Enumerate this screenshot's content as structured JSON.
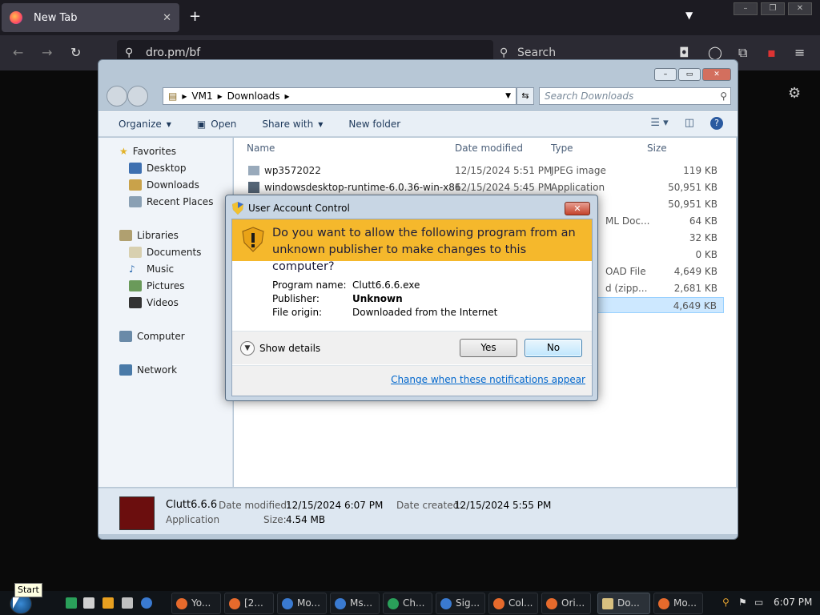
{
  "browser": {
    "tab_label": "New Tab",
    "tab_close": "✕",
    "new_tab": "+",
    "url": "dro.pm/bf",
    "search_placeholder": "Search"
  },
  "explorer": {
    "breadcrumb": [
      "VM1",
      "Downloads"
    ],
    "search_placeholder": "Search Downloads",
    "toolbar": {
      "organize": "Organize",
      "open": "Open",
      "share_with": "Share with",
      "new_folder": "New folder"
    },
    "nav": {
      "favorites": "Favorites",
      "desktop": "Desktop",
      "downloads": "Downloads",
      "recent": "Recent Places",
      "libraries": "Libraries",
      "documents": "Documents",
      "music": "Music",
      "pictures": "Pictures",
      "videos": "Videos",
      "computer": "Computer",
      "network": "Network"
    },
    "columns": {
      "name": "Name",
      "date": "Date modified",
      "type": "Type",
      "size": "Size"
    },
    "rows": [
      {
        "name": "wp3572022",
        "date": "12/15/2024 5:51 PM",
        "type": "JPEG image",
        "size": "119 KB"
      },
      {
        "name": "windowsdesktop-runtime-6.0.36-win-x86",
        "date": "12/15/2024 5:45 PM",
        "type": "Application",
        "size": "50,951 KB"
      },
      {
        "name": "",
        "date": "",
        "type": "",
        "size": "50,951 KB"
      },
      {
        "name": "",
        "date": "",
        "type": "ML Doc...",
        "size": "64 KB"
      },
      {
        "name": "",
        "date": "",
        "type": "",
        "size": "32 KB"
      },
      {
        "name": "",
        "date": "",
        "type": "",
        "size": "0 KB"
      },
      {
        "name": "",
        "date": "",
        "type": "OAD File",
        "size": "4,649 KB"
      },
      {
        "name": "",
        "date": "",
        "type": "d (zipp...",
        "size": "2,681 KB"
      },
      {
        "name": "",
        "date": "",
        "type": "",
        "size": "4,649 KB"
      }
    ],
    "details": {
      "name": "Clutt6.6.6",
      "kind": "Application",
      "modified_label": "Date modified:",
      "modified": "12/15/2024 6:07 PM",
      "size_label": "Size:",
      "size": "4.54 MB",
      "created_label": "Date created:",
      "created": "12/15/2024 5:55 PM"
    }
  },
  "uac": {
    "title": "User Account Control",
    "question_line1": "Do you want to allow the following program from an",
    "question_line2": "unknown publisher to make changes to this computer?",
    "program_label": "Program name:",
    "program_value": "Clutt6.6.6.exe",
    "publisher_label": "Publisher:",
    "publisher_value": "Unknown",
    "origin_label": "File origin:",
    "origin_value": "Downloaded from the Internet",
    "show_details": "Show details",
    "yes": "Yes",
    "no": "No",
    "link": "Change when these notifications appear"
  },
  "taskbar": {
    "start_tooltip": "Start",
    "buttons": [
      "Yo...",
      "[2...",
      "Mo...",
      "Ms...",
      "Ch...",
      "Sig...",
      "Col...",
      "Ori...",
      "Do...",
      "Mo..."
    ],
    "clock": "6:07 PM"
  },
  "colors": {
    "uac_banner": "#f5b82c",
    "accent_link": "#0066cc"
  }
}
